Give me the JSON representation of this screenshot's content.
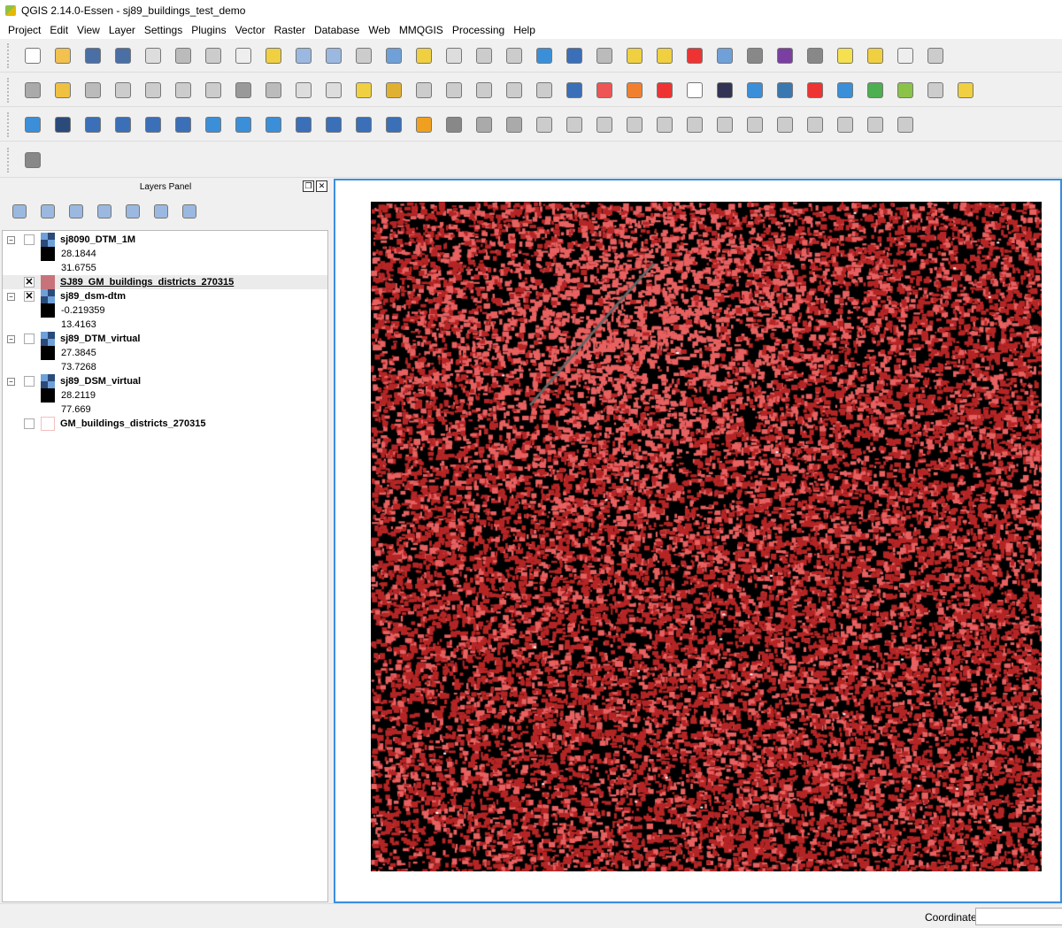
{
  "window": {
    "title": "QGIS 2.14.0-Essen - sj89_buildings_test_demo"
  },
  "menu": [
    "Project",
    "Edit",
    "View",
    "Layer",
    "Settings",
    "Plugins",
    "Vector",
    "Raster",
    "Database",
    "Web",
    "MMQGIS",
    "Processing",
    "Help"
  ],
  "toolbar1": [
    [
      "new-project",
      "#fff"
    ],
    [
      "open-project",
      "#f2c14e"
    ],
    [
      "save-project",
      "#4a6fa5"
    ],
    [
      "save-as",
      "#4a6fa5"
    ],
    [
      "new-print-composer",
      "#ddd"
    ],
    [
      "composer-manager",
      "#bbb"
    ],
    [
      "touch-zoom",
      "#ccc"
    ],
    [
      "pan",
      "#eee"
    ],
    [
      "pan-to-selection",
      "#f0d040"
    ],
    [
      "zoom-in",
      "#9bb9e0"
    ],
    [
      "zoom-out",
      "#9bb9e0"
    ],
    [
      "zoom-native",
      "#ccc"
    ],
    [
      "zoom-full",
      "#6fa0d8"
    ],
    [
      "zoom-to-selection",
      "#f0d040"
    ],
    [
      "zoom-to-layer",
      "#ddd"
    ],
    [
      "zoom-last",
      "#ccc"
    ],
    [
      "zoom-next",
      "#ccc"
    ],
    [
      "refresh",
      "#3b8fd8"
    ],
    [
      "identify",
      "#3b6fb8"
    ],
    [
      "run-action",
      "#bbb"
    ],
    [
      "select-features",
      "#f0d040"
    ],
    [
      "deselect",
      "#f0d040"
    ],
    [
      "select-by-expression",
      "#e33"
    ],
    [
      "attribute-table",
      "#6fa0d8"
    ],
    [
      "field-calculator",
      "#888"
    ],
    [
      "statistics",
      "#7a3fa0"
    ],
    [
      "measure",
      "#888"
    ],
    [
      "map-tips",
      "#f5e050"
    ],
    [
      "new-bookmark",
      "#f0d040"
    ],
    [
      "show-bookmarks",
      "#eee"
    ],
    [
      "text-annotation",
      "#ccc"
    ]
  ],
  "toolbar2": [
    [
      "current-edits",
      "#aaa"
    ],
    [
      "toggle-editing",
      "#f0c040"
    ],
    [
      "save-edits",
      "#bbb"
    ],
    [
      "add-feature",
      "#ccc"
    ],
    [
      "move-feature",
      "#ccc"
    ],
    [
      "node-tool",
      "#ccc"
    ],
    [
      "node-tool-2",
      "#ccc"
    ],
    [
      "delete-selected",
      "#999"
    ],
    [
      "cut-features",
      "#bbb"
    ],
    [
      "copy-features",
      "#ddd"
    ],
    [
      "paste-features",
      "#ddd"
    ],
    [
      "label-tool",
      "#f0d040"
    ],
    [
      "pin-labels",
      "#e0b030"
    ],
    [
      "highlight-labels",
      "#ccc"
    ],
    [
      "show-hide-labels",
      "#ccc"
    ],
    [
      "move-label",
      "#ccc"
    ],
    [
      "rotate-label",
      "#ccc"
    ],
    [
      "change-label",
      "#ccc"
    ],
    [
      "georeferencer",
      "#3b6fb8"
    ],
    [
      "digitizing",
      "#e55"
    ],
    [
      "report",
      "#f08030"
    ],
    [
      "ring-tool",
      "#e33"
    ],
    [
      "csw",
      "#fff"
    ],
    [
      "openlayers",
      "#335"
    ],
    [
      "metasearch",
      "#3b8fd8"
    ],
    [
      "python-console",
      "#3b78b0"
    ],
    [
      "gml",
      "#e33"
    ],
    [
      "search",
      "#3b8fd8"
    ],
    [
      "qgis-cloud",
      "#4caf50"
    ],
    [
      "processing",
      "#8bc34a"
    ],
    [
      "svg",
      "#ccc"
    ],
    [
      "vertex-tool",
      "#f0d040"
    ]
  ],
  "toolbar3": [
    [
      "add-vector",
      "#3b8fd8"
    ],
    [
      "add-raster",
      "#2a4a7a"
    ],
    [
      "add-postgis",
      "#3b6fb8"
    ],
    [
      "add-spatialite",
      "#3b6fb8"
    ],
    [
      "add-mssql",
      "#3b6fb8"
    ],
    [
      "add-oracle",
      "#3b6fb8"
    ],
    [
      "add-wms",
      "#3b8fd8"
    ],
    [
      "add-wcs",
      "#3b8fd8"
    ],
    [
      "add-wfs",
      "#3b8fd8"
    ],
    [
      "add-delimited-text",
      "#3b6fb8"
    ],
    [
      "add-virtual-layer",
      "#3b6fb8"
    ],
    [
      "new-shapefile",
      "#3b6fb8"
    ],
    [
      "new-spatialite",
      "#3b6fb8"
    ],
    [
      "advanced-digitize",
      "#f0a020"
    ],
    [
      "rotate",
      "#888"
    ],
    [
      "undo",
      "#aaa"
    ],
    [
      "redo",
      "#aaa"
    ],
    [
      "simplify",
      "#ccc"
    ],
    [
      "add-ring",
      "#ccc"
    ],
    [
      "add-part",
      "#ccc"
    ],
    [
      "fill-ring",
      "#ccc"
    ],
    [
      "delete-ring",
      "#ccc"
    ],
    [
      "delete-part",
      "#ccc"
    ],
    [
      "reshape",
      "#ccc"
    ],
    [
      "offset-curve",
      "#ccc"
    ],
    [
      "split-features",
      "#ccc"
    ],
    [
      "split-parts",
      "#ccc"
    ],
    [
      "merge-features",
      "#ccc"
    ],
    [
      "merge-attributes",
      "#ccc"
    ],
    [
      "rotate-symbols",
      "#ccc"
    ]
  ],
  "toolbar4": [
    [
      "north-arrow",
      "#888"
    ]
  ],
  "layers_panel": {
    "title": "Layers Panel",
    "tools": [
      "add-group",
      "manage-visibility",
      "filter-legend",
      "filter-by-expression",
      "expand-all",
      "collapse-all",
      "remove-layer"
    ],
    "layers": [
      {
        "name": "sj8090_DTM_1M",
        "checked": false,
        "type": "raster",
        "min": "28.1844",
        "max": "31.6755"
      },
      {
        "name": "SJ89_GM_buildings_districts_270315",
        "checked": true,
        "type": "vector",
        "selected": true
      },
      {
        "name": "sj89_dsm-dtm",
        "checked": true,
        "type": "raster",
        "min": "-0.219359",
        "max": "13.4163"
      },
      {
        "name": "sj89_DTM_virtual",
        "checked": false,
        "type": "raster",
        "min": "27.3845",
        "max": "73.7268"
      },
      {
        "name": "sj89_DSM_virtual",
        "checked": false,
        "type": "raster",
        "min": "28.2119",
        "max": "77.669"
      },
      {
        "name": "GM_buildings_districts_270315",
        "checked": false,
        "type": "vector-empty"
      }
    ]
  },
  "status": {
    "coordinate_label": "Coordinate",
    "coordinate_value": ""
  },
  "colors": {
    "building_fill": "#d63a3a",
    "map_bg": "#000000",
    "canvas_border": "#3c8ee0"
  }
}
